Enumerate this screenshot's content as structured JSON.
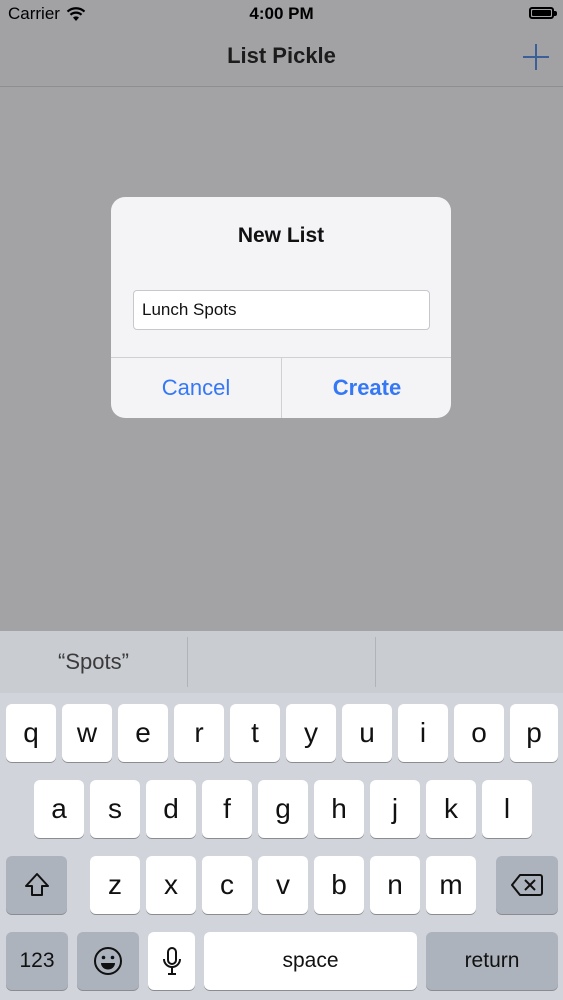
{
  "status_bar": {
    "carrier": "Carrier",
    "time": "4:00 PM"
  },
  "nav": {
    "title": "List Pickle",
    "add_icon": "plus-icon"
  },
  "alert": {
    "title": "New List",
    "input_value": "Lunch Spots",
    "cancel_label": "Cancel",
    "create_label": "Create"
  },
  "predictive": {
    "suggestion_1": "“Spots”",
    "suggestion_2": "",
    "suggestion_3": ""
  },
  "keyboard": {
    "row1": [
      "q",
      "w",
      "e",
      "r",
      "t",
      "y",
      "u",
      "i",
      "o",
      "p"
    ],
    "row2": [
      "a",
      "s",
      "d",
      "f",
      "g",
      "h",
      "j",
      "k",
      "l"
    ],
    "row3": [
      "z",
      "x",
      "c",
      "v",
      "b",
      "n",
      "m"
    ],
    "numbers_label": "123",
    "space_label": "space",
    "return_label": "return"
  },
  "colors": {
    "accent": "#3478f6",
    "dim_background": "#a3a3a6",
    "keyboard_bg": "#d1d4da"
  }
}
